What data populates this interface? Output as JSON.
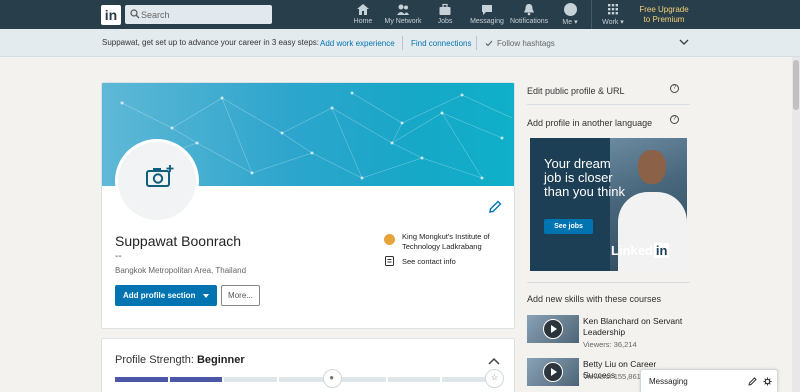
{
  "nav": {
    "logo": "in",
    "search_placeholder": "Search",
    "items": [
      {
        "label": "Home",
        "icon": "home-icon"
      },
      {
        "label": "My Network",
        "icon": "network-icon"
      },
      {
        "label": "Jobs",
        "icon": "jobs-icon"
      },
      {
        "label": "Messaging",
        "icon": "messaging-icon"
      },
      {
        "label": "Notifications",
        "icon": "notifications-icon"
      },
      {
        "label": "Me ▾",
        "icon": "avatar"
      },
      {
        "label": "Work ▾",
        "icon": "grid-icon"
      }
    ],
    "upgrade_line1": "Free Upgrade",
    "upgrade_line2": "to Premium"
  },
  "guidance": {
    "text": "Suppawat, get set up to advance your career in 3 easy steps:",
    "step1": "Add work experience",
    "step2": "Find connections",
    "step3": "Follow hashtags"
  },
  "profile": {
    "name": "Suppawat Boonrach",
    "headline": "--",
    "location": "Bangkok Metropolitan Area, Thailand",
    "add_section_label": "Add profile section",
    "more_label": "More...",
    "school": "King Mongkut's Institute of Technology Ladkrabang",
    "contact_info": "See contact info"
  },
  "strength": {
    "label": "Profile Strength: ",
    "level": "Beginner",
    "segments_filled": 2,
    "segments_total": 7
  },
  "rail": {
    "edit_url": "Edit public profile & URL",
    "add_language": "Add profile in another language",
    "ad_text": "Your dream job is closer than you think",
    "ad_button": "See jobs",
    "ad_logo_word": "Linked",
    "ad_logo_in": "in",
    "courses_title": "Add new skills with these courses",
    "courses": [
      {
        "title": "Ken Blanchard on Servant Leadership",
        "viewers": "Viewers: 36,214"
      },
      {
        "title": "Betty Liu on Career Success",
        "viewers": "Viewers: 155,861"
      }
    ]
  },
  "messaging": {
    "label": "Messaging"
  },
  "colors": {
    "nav_bg": "#283e4a",
    "accent": "#0073b1",
    "upgrade": "#f5d07a",
    "meter_fill": "#4c57a8"
  }
}
